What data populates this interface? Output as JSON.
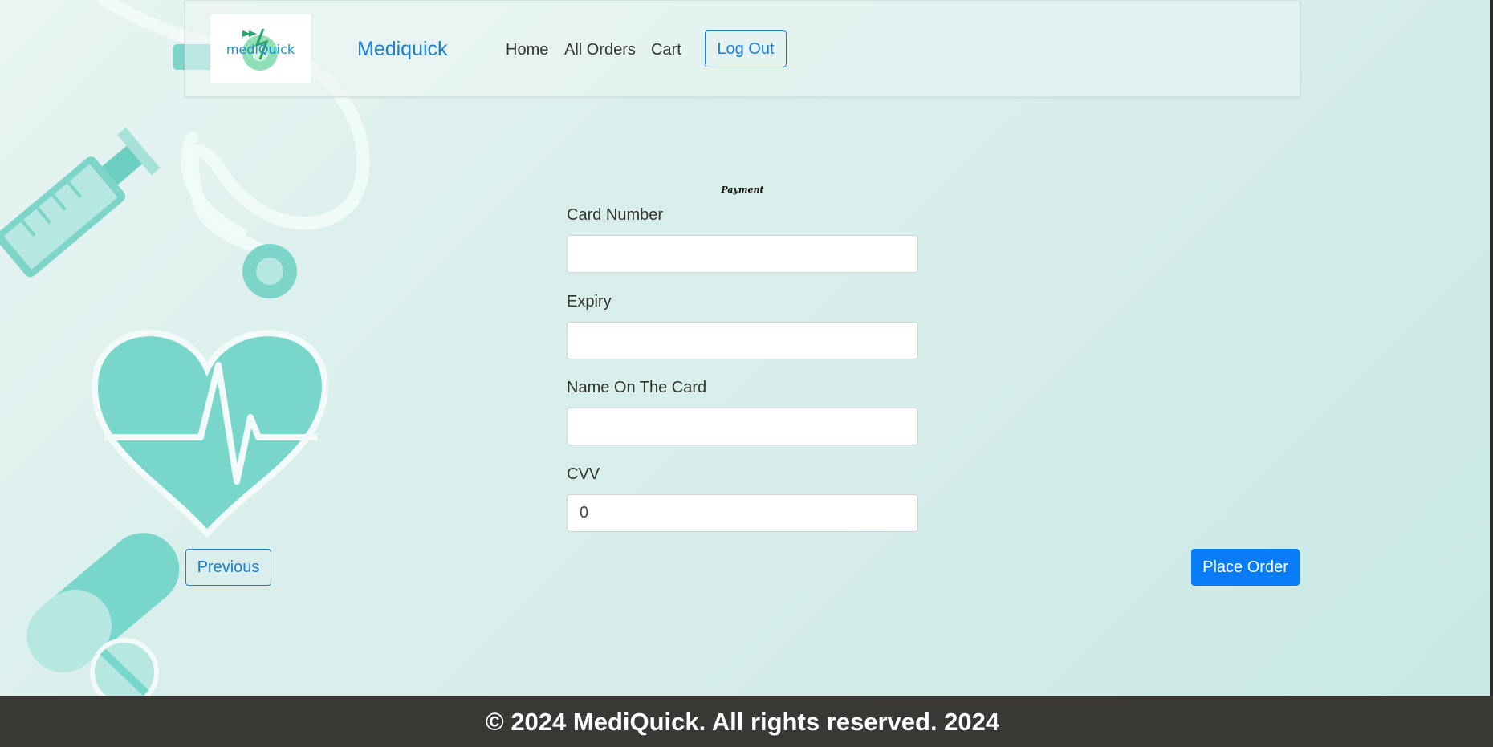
{
  "navbar": {
    "logo_text": "mediQuick",
    "brand": "Mediquick",
    "links": [
      "Home",
      "All Orders",
      "Cart"
    ],
    "logout_label": "Log Out"
  },
  "form": {
    "title": "Payment",
    "fields": [
      {
        "label": "Card Number",
        "value": ""
      },
      {
        "label": "Expiry",
        "value": ""
      },
      {
        "label": "Name On The Card",
        "value": ""
      },
      {
        "label": "CVV",
        "value": "0"
      }
    ]
  },
  "actions": {
    "previous_label": "Previous",
    "place_order_label": "Place Order"
  },
  "footer": {
    "text": "© 2024 MediQuick. All rights reserved. 2024"
  },
  "colors": {
    "primary": "#0a7cf7",
    "brand_blue": "#1a7fd4",
    "teal": "#78d6cb",
    "footer_bg": "#3a3835"
  }
}
